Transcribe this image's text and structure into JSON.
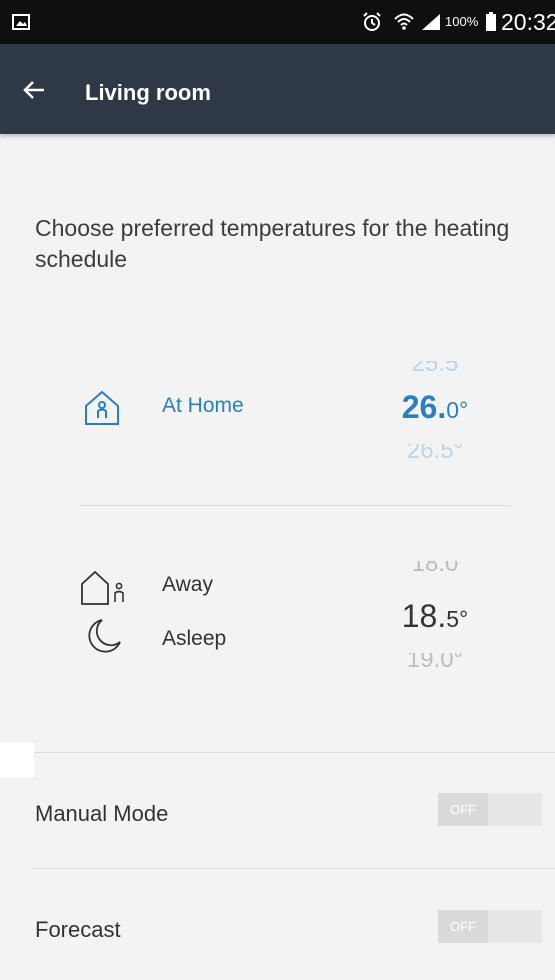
{
  "status_bar": {
    "battery_percent": "100%",
    "time": "20:32"
  },
  "app_bar": {
    "title": "Living room",
    "back_icon": "arrow-left-icon"
  },
  "intro_text": "Choose preferred temperatures for the heating schedule",
  "modes": {
    "home": {
      "label": "At Home",
      "icon": "house-person-icon",
      "temp_prev": "25.5",
      "temp_int": "26.",
      "temp_dec": "0°",
      "temp_next": "26.5°"
    },
    "away": {
      "label": "Away",
      "icon": "house-outline-person-icon",
      "temp_prev": "18.0",
      "temp_int": "18.",
      "temp_dec": "5°",
      "temp_next": "19.0°"
    },
    "asleep": {
      "label": "Asleep",
      "icon": "moon-icon"
    }
  },
  "settings": {
    "manual_mode": {
      "label": "Manual Mode",
      "state": "OFF"
    },
    "forecast": {
      "label": "Forecast",
      "state": "OFF"
    }
  },
  "colors": {
    "app_bar": "#2e3847",
    "accent": "#2a7fc0",
    "background": "#f3f3f3"
  }
}
